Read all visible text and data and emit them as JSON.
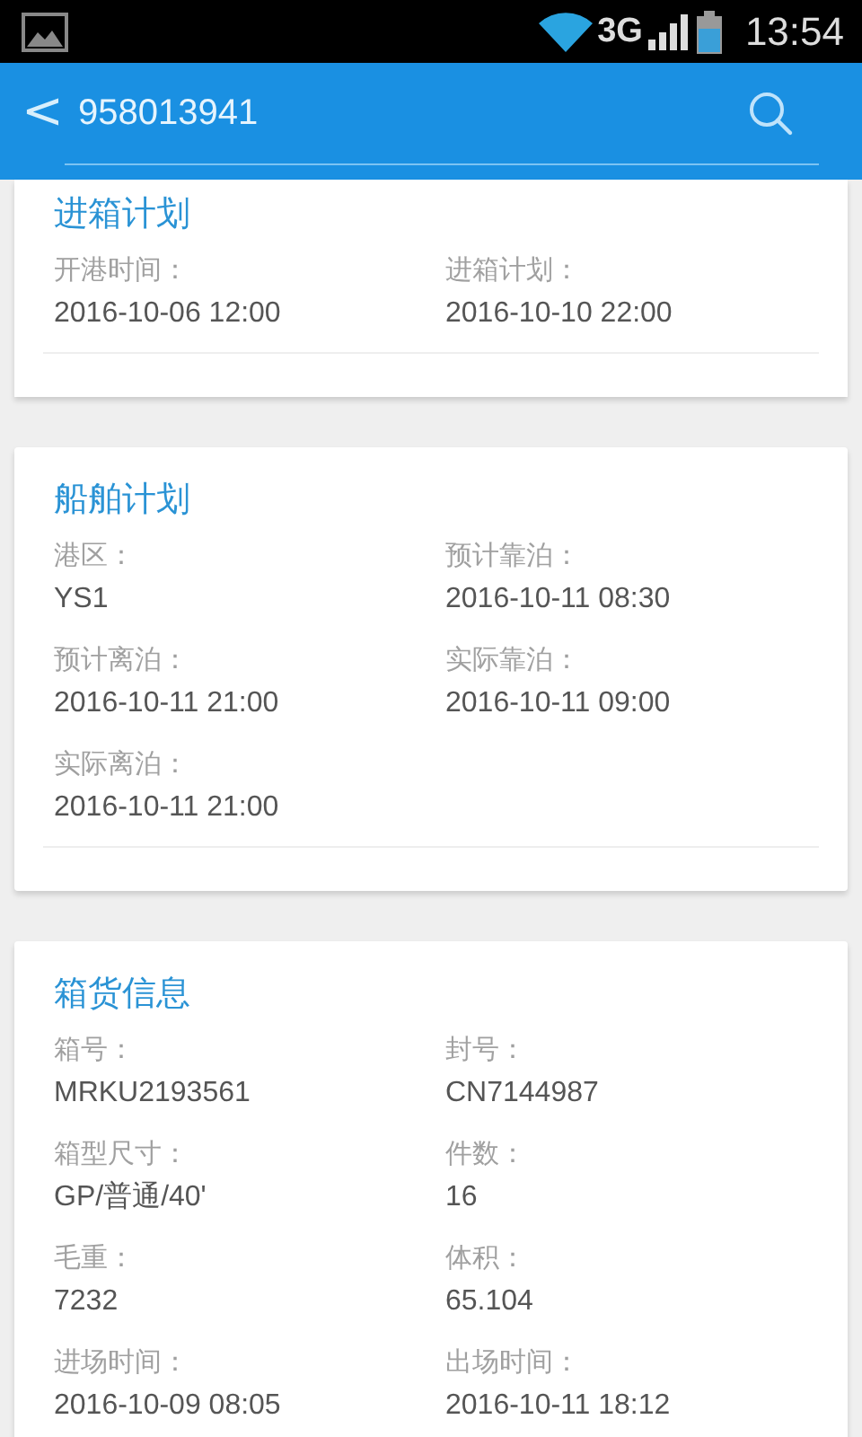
{
  "status_bar": {
    "network": "3G",
    "time": "13:54"
  },
  "header": {
    "back": "<",
    "title": "958013941"
  },
  "sections": [
    {
      "title": "进箱计划",
      "fields": [
        {
          "label": "开港时间：",
          "value": "2016-10-06 12:00"
        },
        {
          "label": "进箱计划：",
          "value": "2016-10-10 22:00"
        }
      ]
    },
    {
      "title": "船舶计划",
      "fields": [
        {
          "label": "港区：",
          "value": "YS1"
        },
        {
          "label": "预计靠泊：",
          "value": "2016-10-11 08:30"
        },
        {
          "label": "预计离泊：",
          "value": "2016-10-11 21:00"
        },
        {
          "label": "实际靠泊：",
          "value": "2016-10-11 09:00"
        },
        {
          "label": "实际离泊：",
          "value": "2016-10-11 21:00"
        }
      ]
    },
    {
      "title": "箱货信息",
      "fields": [
        {
          "label": "箱号：",
          "value": "MRKU2193561"
        },
        {
          "label": "封号：",
          "value": "CN7144987"
        },
        {
          "label": "箱型尺寸：",
          "value": "GP/普通/40'"
        },
        {
          "label": "件数：",
          "value": "16"
        },
        {
          "label": "毛重：",
          "value": "7232"
        },
        {
          "label": "体积：",
          "value": "65.104"
        },
        {
          "label": "进场时间：",
          "value": "2016-10-09 08:05"
        },
        {
          "label": "出场时间：",
          "value": "2016-10-11 18:12"
        }
      ]
    }
  ]
}
